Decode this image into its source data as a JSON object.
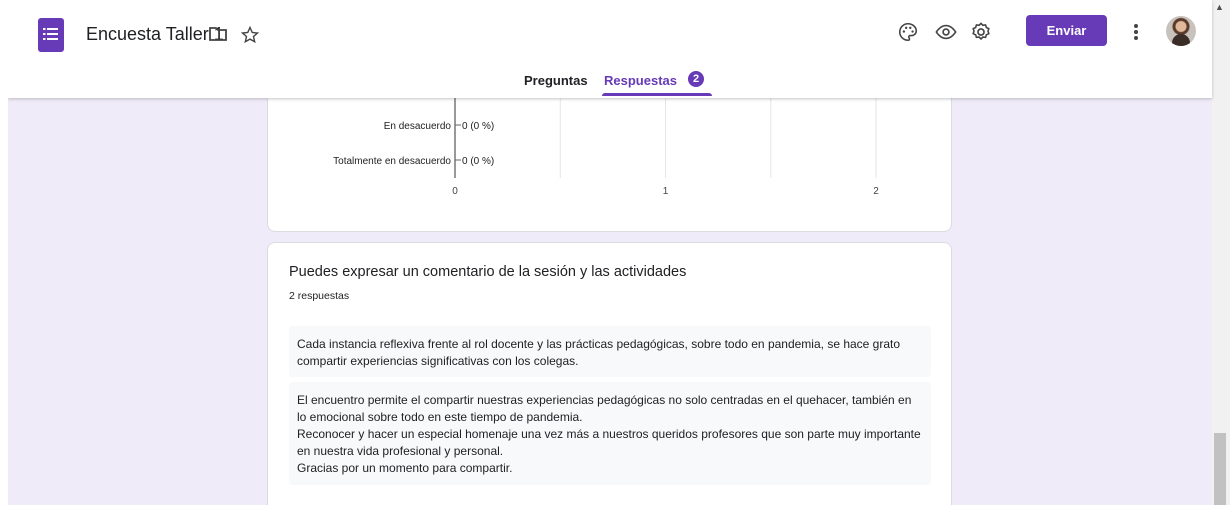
{
  "header": {
    "title": "Encuesta Taller 1",
    "send_label": "Enviar",
    "icons": [
      "forms-logo-icon",
      "folder-icon",
      "star-icon",
      "palette-icon",
      "eye-icon",
      "settings-icon",
      "more-vert-icon"
    ]
  },
  "tabs": {
    "questions_label": "Preguntas",
    "responses_label": "Respuestas",
    "responses_count": "2"
  },
  "chart_data": {
    "type": "bar",
    "orientation": "horizontal",
    "categories": [
      "En desacuerdo",
      "Totalmente en desacuerdo"
    ],
    "values": [
      0,
      0
    ],
    "value_labels": [
      "0 (0 %)",
      "0 (0 %)"
    ],
    "xticks": [
      "0",
      "1",
      "2"
    ],
    "xlim": [
      0,
      2
    ],
    "grid": true
  },
  "question": {
    "title": "Puedes expresar un comentario de la sesión y las actividades",
    "count": "2 respuestas",
    "answers": [
      "Cada instancia reflexiva frente al rol docente y las prácticas pedagógicas, sobre todo en pandemia, se hace grato compartir experiencias significativas con los colegas.",
      "El encuentro permite el compartir nuestras experiencias pedagógicas no solo centradas en el quehacer, también en lo emocional sobre todo en este tiempo de pandemia.\nReconocer y hacer un especial homenaje una vez más a nuestros queridos profesores que son parte muy importante en nuestra vida profesional y personal.\nGracias por un momento para compartir."
    ]
  },
  "colors": {
    "accent": "#673ab7",
    "background": "#f0ebf8"
  }
}
